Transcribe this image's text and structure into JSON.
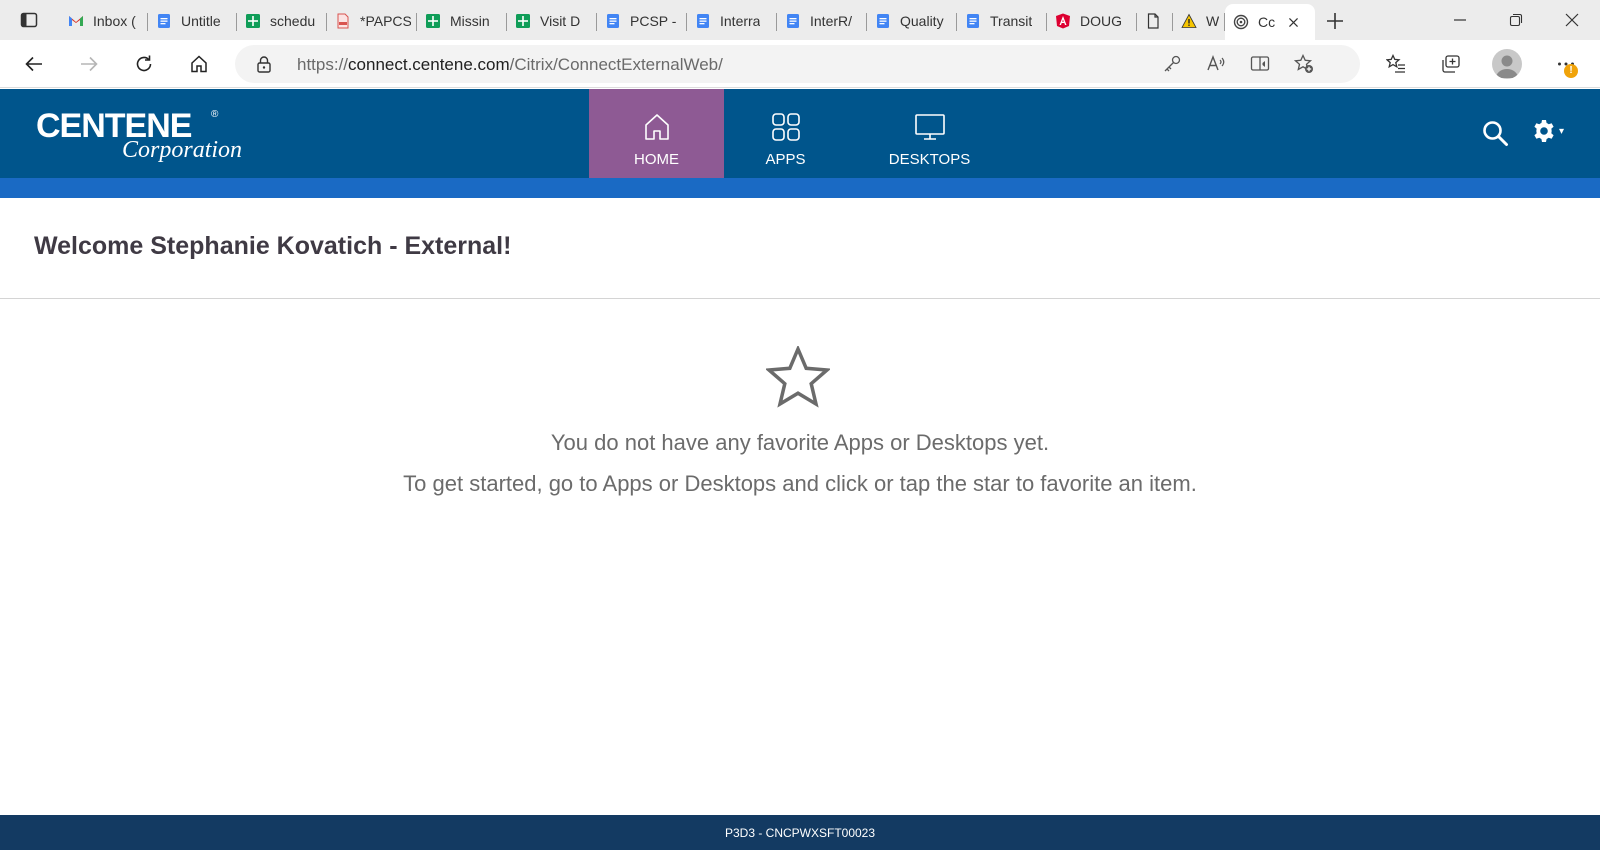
{
  "browser": {
    "tabs": [
      {
        "title": "Inbox (",
        "icon": "gmail-icon"
      },
      {
        "title": "Untitle",
        "icon": "docs-icon"
      },
      {
        "title": "schedu",
        "icon": "sheets-icon"
      },
      {
        "title": "*PAPCS",
        "icon": "pdf-icon"
      },
      {
        "title": "Missin",
        "icon": "sheets-icon"
      },
      {
        "title": "Visit D",
        "icon": "sheets-icon"
      },
      {
        "title": "PCSP -",
        "icon": "docs-icon"
      },
      {
        "title": "Interra",
        "icon": "docs-icon"
      },
      {
        "title": "InterR/",
        "icon": "docs-icon"
      },
      {
        "title": "Quality",
        "icon": "docs-icon"
      },
      {
        "title": "Transit",
        "icon": "docs-icon"
      },
      {
        "title": "DOUG",
        "icon": "angular-icon"
      },
      {
        "title": "",
        "icon": "page-icon"
      },
      {
        "title": "Wa",
        "icon": "warning-icon"
      },
      {
        "title": "Cc",
        "icon": "citrix-icon",
        "active": true
      }
    ],
    "url_prefix": "https://",
    "url_host": "connect.centene.com",
    "url_path": "/Citrix/ConnectExternalWeb/",
    "more_badge": "!"
  },
  "header": {
    "logo_brand": "CENTENE",
    "logo_registered": "®",
    "logo_sub": "Corporation",
    "nav": {
      "home": "HOME",
      "apps": "APPS",
      "desktops": "DESKTOPS"
    },
    "gear_caret": "▾"
  },
  "main": {
    "welcome": "Welcome Stephanie Kovatich - External!",
    "empty_line1": "You do not have any favorite Apps or Desktops yet.",
    "empty_line2": "To get started, go to Apps or Desktops and click or tap the star to favorite an item."
  },
  "footer": {
    "text": "P3D3 - CNCPWXSFT00023"
  },
  "colors": {
    "header_bg": "#00558c",
    "home_active_bg": "#8e5a94",
    "accent_bar": "#1a6ac4",
    "footer_bg": "#133a62"
  }
}
